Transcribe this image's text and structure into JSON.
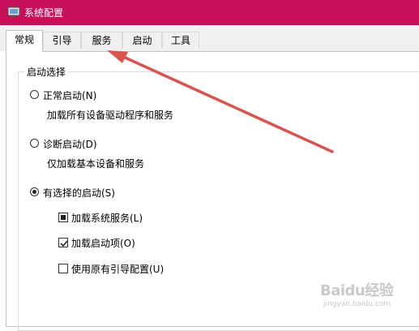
{
  "window": {
    "title": "系统配置",
    "accent_color": "#c80f5a"
  },
  "tabs": [
    {
      "label": "常规",
      "active": true
    },
    {
      "label": "引导",
      "active": false
    },
    {
      "label": "服务",
      "active": false
    },
    {
      "label": "启动",
      "active": false
    },
    {
      "label": "工具",
      "active": false
    }
  ],
  "startup_group": {
    "title": "启动选择",
    "options": [
      {
        "label": "正常启动(N)",
        "description": "加载所有设备驱动程序和服务",
        "selected": false
      },
      {
        "label": "诊断启动(D)",
        "description": "仅加载基本设备和服务",
        "selected": false
      },
      {
        "label": "有选择的启动(S)",
        "selected": true
      }
    ],
    "sub_options": [
      {
        "label": "加载系统服务(L)",
        "state": "indeterminate"
      },
      {
        "label": "加载启动项(O)",
        "state": "checked"
      },
      {
        "label": "使用原有引导配置(U)",
        "state": "unchecked"
      }
    ]
  },
  "annotation": {
    "arrow_color": "#d9534f",
    "points_to": "tab-services"
  },
  "watermark": {
    "brand": "Baidu经验",
    "url": "jingyan.baidu.com"
  }
}
